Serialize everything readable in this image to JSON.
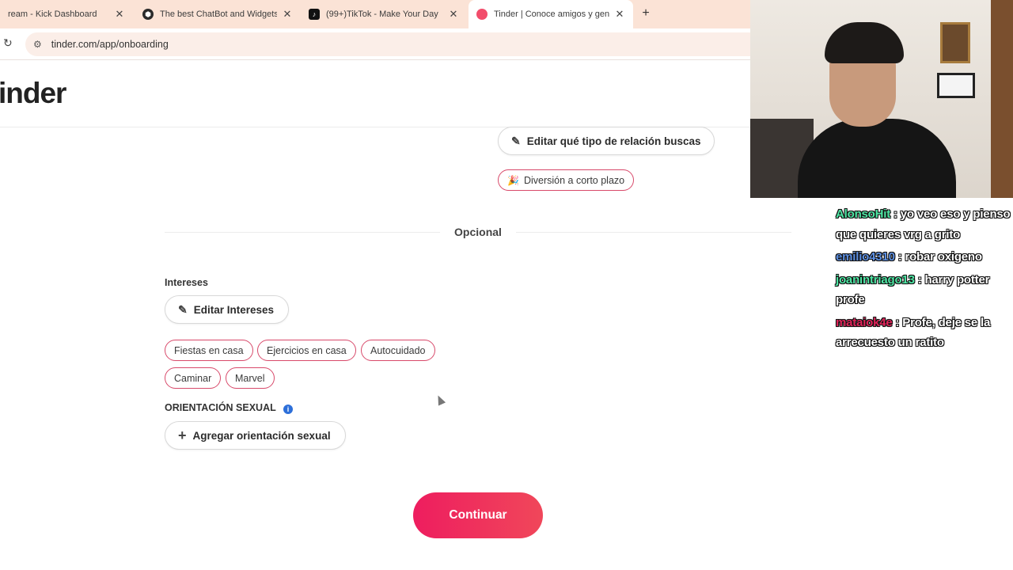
{
  "browser": {
    "tabs": [
      {
        "title": "ream - Kick Dashboard",
        "favicon": "kick-icon"
      },
      {
        "title": "The best ChatBot and Widgets",
        "favicon": "botrix-icon"
      },
      {
        "title": "(99+)TikTok - Make Your Day",
        "favicon": "tiktok-icon"
      },
      {
        "title": "Tinder | Conoce amigos y gente",
        "favicon": "tinder-flame-icon"
      }
    ],
    "active_tab": 3,
    "new_tab": "+",
    "url": "tinder.com/app/onboarding"
  },
  "page": {
    "logo": "inder",
    "edit_relationship_label": "Editar qué tipo de relación buscas",
    "relationship_tag": {
      "emoji": "🎉",
      "label": "Diversión a corto plazo"
    },
    "optional_label": "Opcional",
    "interests_label": "Intereses",
    "edit_interests_label": "Editar Intereses",
    "interests": [
      "Fiestas en casa",
      "Ejercicios en casa",
      "Autocuidado",
      "Caminar",
      "Marvel"
    ],
    "orientation_label": "ORIENTACIÓN SEXUAL",
    "add_orientation_label": "Agregar orientación sexual",
    "continue_label": "Continuar"
  },
  "chat": [
    {
      "user": "AlonsoHit",
      "color": "#4ee6a4",
      "text": ": yo veo eso y pienso que quieres vrg a grito"
    },
    {
      "user": "emilio4310",
      "color": "#5c8ee0",
      "text": ": robar oxigeno"
    },
    {
      "user": "joanintriago13",
      "color": "#4ee6a4",
      "text": ": harry potter profe"
    },
    {
      "user": "mataiok4e",
      "color": "#e0245a",
      "text": ": Profe, deje se la arrecuesto un ratito"
    }
  ],
  "colors": {
    "brand": "#ee1d5f",
    "tag_border": "#d8496a"
  }
}
